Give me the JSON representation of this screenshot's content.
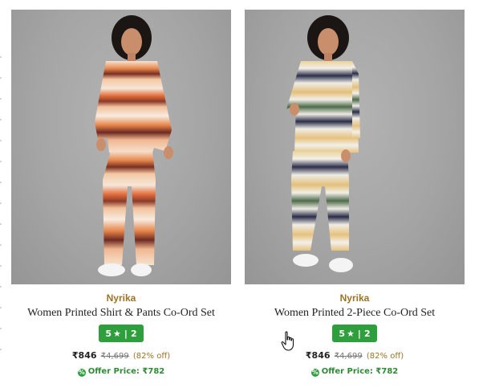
{
  "products": [
    {
      "image_alt": "Women wearing orange and maroon printed shirt and pants co-ord set",
      "brand": "Nyrika",
      "title": "Women Printed Shirt & Pants Co-Ord Set",
      "rating": "5",
      "star": "★",
      "reviews": "2",
      "price": "₹846",
      "mrp": "₹4,699",
      "discount": "(82% off)",
      "offer_label": "Offer Price: ₹782",
      "offer_icon": "offer-tag-icon"
    },
    {
      "image_alt": "Women wearing green, navy and yellow striped 2-piece co-ord set",
      "brand": "Nyrika",
      "title": "Women Printed 2-Piece Co-Ord Set",
      "rating": "5",
      "star": "★",
      "reviews": "2",
      "price": "₹846",
      "mrp": "₹4,699",
      "discount": "(82% off)",
      "offer_label": "Offer Price: ₹782",
      "offer_icon": "offer-tag-icon"
    }
  ],
  "colors": {
    "brand_text": "#9a7326",
    "rating_badge": "#2f9e3c",
    "offer_text": "#2f8a35"
  },
  "cursor": "hand-pointer-icon"
}
